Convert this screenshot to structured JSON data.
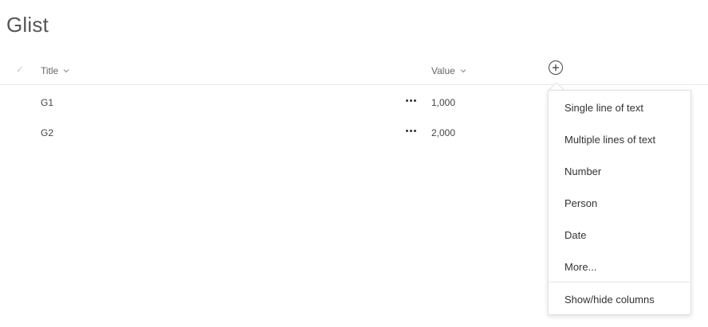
{
  "page": {
    "title": "Glist"
  },
  "columns": {
    "title_label": "Title",
    "value_label": "Value",
    "select_all_icon": "check-icon",
    "add_column_icon": "add-circle-icon"
  },
  "rows": [
    {
      "title": "G1",
      "value": "1,000"
    },
    {
      "title": "G2",
      "value": "2,000"
    }
  ],
  "add_column_menu": {
    "items": [
      "Single line of text",
      "Multiple lines of text",
      "Number",
      "Person",
      "Date",
      "More..."
    ],
    "footer_item": "Show/hide columns"
  }
}
